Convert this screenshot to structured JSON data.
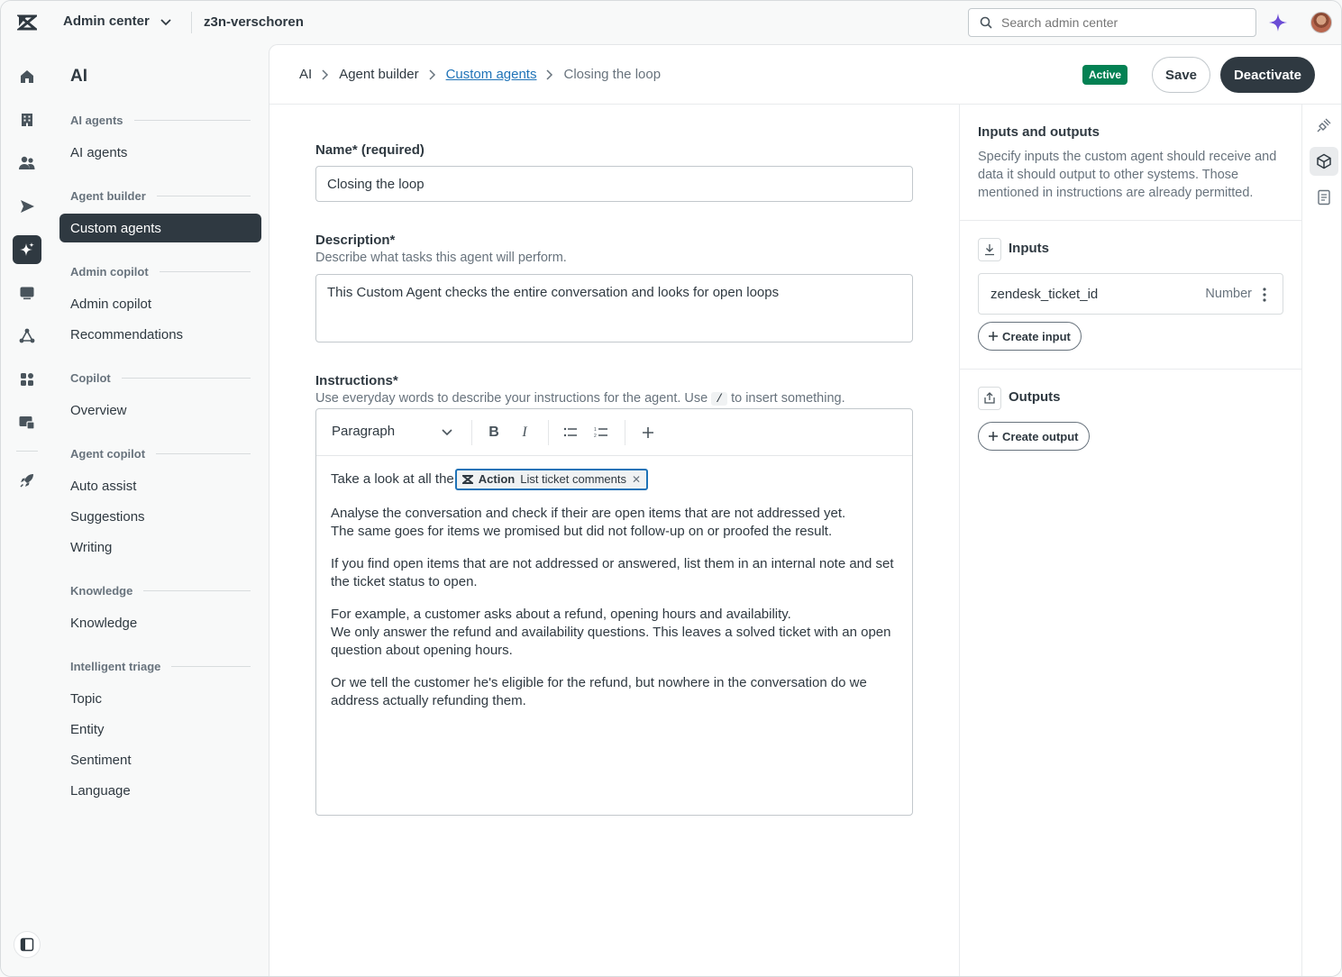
{
  "header": {
    "product_name": "Admin center",
    "account_name": "z3n-verschoren",
    "search_placeholder": "Search admin center"
  },
  "rail": {
    "icons": [
      "home-icon",
      "building-icon",
      "people-icon",
      "send-icon",
      "ai-sparkle-icon",
      "chat-icon",
      "objects-icon",
      "apps-icon",
      "workspaces-icon",
      "rocket-icon"
    ],
    "active": "ai-sparkle-icon"
  },
  "sidebar": {
    "title": "AI",
    "sections": [
      {
        "label": "AI agents",
        "items": [
          "AI agents"
        ]
      },
      {
        "label": "Agent builder",
        "items": [
          "Custom agents"
        ]
      },
      {
        "label": "Admin copilot",
        "items": [
          "Admin copilot",
          "Recommendations"
        ]
      },
      {
        "label": "Copilot",
        "items": [
          "Overview"
        ]
      },
      {
        "label": "Agent copilot",
        "items": [
          "Auto assist",
          "Suggestions",
          "Writing"
        ]
      },
      {
        "label": "Knowledge",
        "items": [
          "Knowledge"
        ]
      },
      {
        "label": "Intelligent triage",
        "items": [
          "Topic",
          "Entity",
          "Sentiment",
          "Language"
        ]
      }
    ],
    "active_item": "Custom agents"
  },
  "breadcrumb": [
    "AI",
    "Agent builder",
    "Custom agents",
    "Closing the loop"
  ],
  "status_badge": "Active",
  "actions": {
    "save": "Save",
    "deactivate": "Deactivate"
  },
  "form": {
    "name_label": "Name* (required)",
    "name_value": "Closing the loop",
    "description_label": "Description*",
    "description_hint": "Describe what tasks this agent will perform.",
    "description_value": "This Custom Agent checks the entire conversation and looks for open loops",
    "instructions_label": "Instructions*",
    "instructions_hint_before": "Use everyday words to describe your instructions for the agent. Use",
    "instructions_hint_key": "/",
    "instructions_hint_after": "to insert something.",
    "toolbar": {
      "format_select": "Paragraph"
    },
    "instructions": {
      "line1_prefix": "Take a look at all the",
      "action_pill": {
        "type": "Action",
        "name": "List ticket comments"
      },
      "paragraphs": [
        [
          "Analyse the conversation and check if their are open items that are not addressed yet.",
          "The same goes for items we promised but did not follow-up on or proofed the result."
        ],
        [
          "If you find open items that are not addressed or answered, list them in an internal note and set the ticket status to open."
        ],
        [
          "For example, a customer asks about a refund, opening hours and availability.",
          "We only answer the refund and availability questions. This leaves a solved ticket with an open question about opening hours."
        ],
        [
          "Or we tell the customer he's eligible for the refund, but nowhere in the conversation do we address actually refunding them."
        ]
      ]
    }
  },
  "io_panel": {
    "title": "Inputs and outputs",
    "description": "Specify inputs the custom agent should receive and data it should output to other systems. Those mentioned in instructions are already permitted.",
    "inputs_heading": "Inputs",
    "inputs": [
      {
        "name": "zendesk_ticket_id",
        "type": "Number"
      }
    ],
    "create_input": "Create input",
    "outputs_heading": "Outputs",
    "create_output": "Create output"
  }
}
